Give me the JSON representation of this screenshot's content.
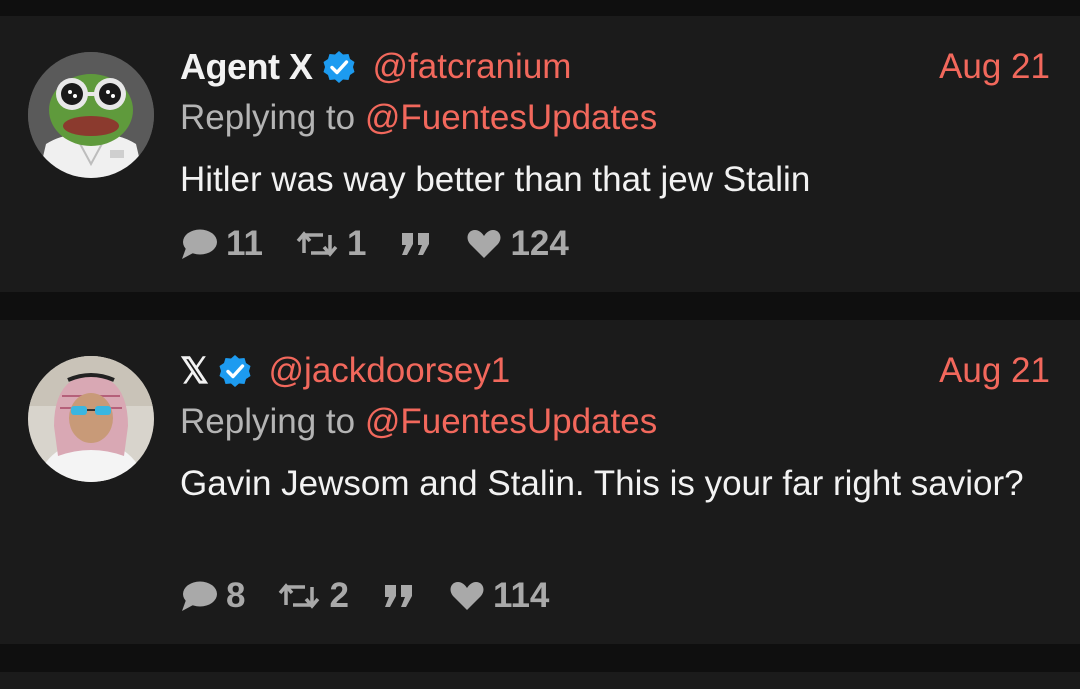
{
  "colors": {
    "page_background": "#0f0f0f",
    "card_background": "#1b1b1b",
    "primary_text": "#f2f2f2",
    "secondary_text": "#b4b4b4",
    "accent": "#f2685c",
    "icon_gray": "#a9a9a9",
    "verified_badge": "#1d9bf0"
  },
  "tweets": [
    {
      "display_name": "Agent X",
      "verified": true,
      "handle": "@fatcranium",
      "date": "Aug 21",
      "replying_label": "Replying to",
      "replying_to": "@FuentesUpdates",
      "text": "Hitler was way better than that jew Stalin",
      "avatar": "frog-cartoon-avatar",
      "stats": {
        "replies": "11",
        "retweets": "1",
        "likes": "124"
      }
    },
    {
      "display_name": "𝕏",
      "verified": true,
      "handle": "@jackdoorsey1",
      "date": "Aug 21",
      "replying_label": "Replying to",
      "replying_to": "@FuentesUpdates",
      "text": "Gavin Jewsom and Stalin. This is your far right savior?",
      "avatar": "person-headscarf-avatar",
      "stats": {
        "replies": "8",
        "retweets": "2",
        "likes": "114"
      }
    }
  ],
  "icons": {
    "reply": "speech-bubble-icon",
    "retweet": "retweet-arrows-icon",
    "quote": "quote-marks-icon",
    "like": "heart-icon",
    "verified": "verified-badge-icon"
  }
}
